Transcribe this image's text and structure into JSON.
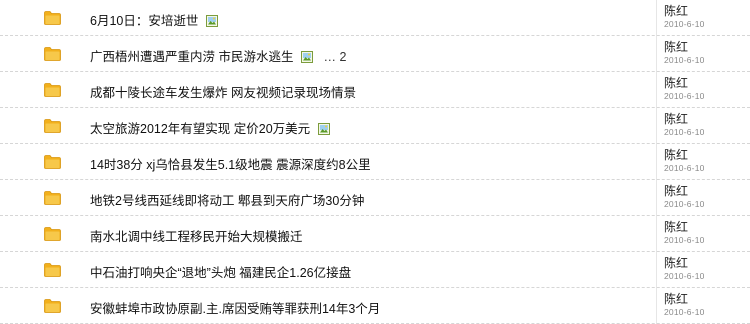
{
  "topics": [
    {
      "title": "6月10日：安培逝世",
      "has_image": true,
      "more": "",
      "author": "陈红",
      "date": "2010-6-10"
    },
    {
      "title": "广西梧州遭遇严重内涝 市民游水逃生",
      "has_image": true,
      "more": "… 2",
      "author": "陈红",
      "date": "2010-6-10"
    },
    {
      "title": "成都十陵长途车发生爆炸 网友视频记录现场情景",
      "has_image": false,
      "more": "",
      "author": "陈红",
      "date": "2010-6-10"
    },
    {
      "title": "太空旅游2012年有望实现 定价20万美元",
      "has_image": true,
      "more": "",
      "author": "陈红",
      "date": "2010-6-10"
    },
    {
      "title": "14时38分 xj乌恰县发生5.1级地震 震源深度约8公里",
      "has_image": false,
      "more": "",
      "author": "陈红",
      "date": "2010-6-10"
    },
    {
      "title": "地铁2号线西延线即将动工 郫县到天府广场30分钟",
      "has_image": false,
      "more": "",
      "author": "陈红",
      "date": "2010-6-10"
    },
    {
      "title": "南水北调中线工程移民开始大规模搬迁",
      "has_image": false,
      "more": "",
      "author": "陈红",
      "date": "2010-6-10"
    },
    {
      "title": "中石油打响央企“退地”头炮 福建民企1.26亿接盘",
      "has_image": false,
      "more": "",
      "author": "陈红",
      "date": "2010-6-10"
    },
    {
      "title": "安徽蚌埠市政协原副.主.席因受贿等罪获刑14年3个月",
      "has_image": false,
      "more": "",
      "author": "陈红",
      "date": "2010-6-10"
    }
  ],
  "colors": {
    "folder": "#f2b01c",
    "folder_dark": "#d8950e",
    "separator": "#d6d6d6"
  }
}
